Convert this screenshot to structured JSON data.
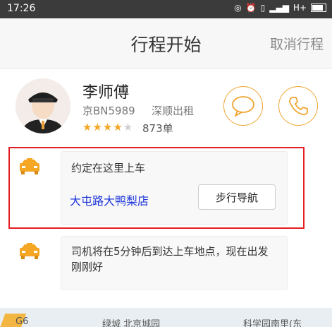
{
  "status": {
    "time": "17:26",
    "network": "H+"
  },
  "nav": {
    "title": "行程开始",
    "cancel": "取消行程"
  },
  "driver": {
    "name": "李师傅",
    "plate": "京BN5989",
    "company": "深顺出租",
    "rating": 4,
    "rating_max": 5,
    "orders": "873单"
  },
  "messages": [
    {
      "title": "约定在这里上车",
      "location": "大屯路大鸭梨店",
      "action": "步行导航"
    },
    {
      "text": "司机将在5分钟后到达上车地点，现在出发刚刚好"
    }
  ],
  "map": {
    "labels": [
      "G6",
      "绿城 北京城园",
      "科学园南里(东"
    ]
  },
  "colors": {
    "accent": "#f0a431",
    "link": "#1a32d9",
    "highlight": "#e31e24"
  }
}
